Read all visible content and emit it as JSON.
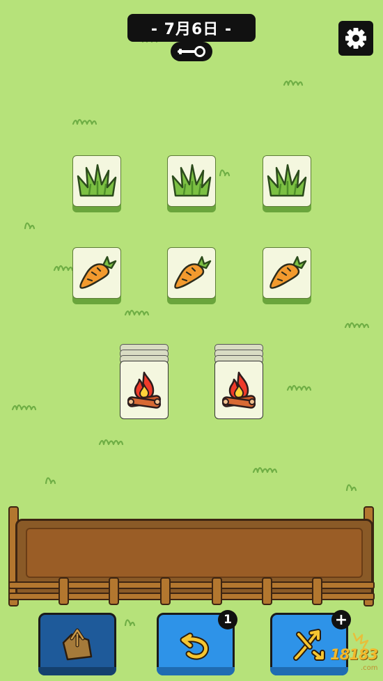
{
  "header": {
    "date_label": "- 7月6日 -",
    "key_icon": "key-icon",
    "settings_icon": "gear-icon"
  },
  "board": {
    "rows": [
      {
        "tiles": [
          "grass",
          "grass",
          "grass"
        ]
      },
      {
        "tiles": [
          "carrot",
          "carrot",
          "carrot"
        ]
      },
      {
        "tiles": [
          "campfire",
          "campfire"
        ]
      }
    ]
  },
  "toolbar": {
    "undo_badge": "1",
    "shuffle_badge": "+"
  },
  "watermark": {
    "text": "18183",
    "domain": ".com"
  },
  "colors": {
    "background": "#b6e27a",
    "tray_wood": "#8a5a27",
    "button_dark_blue": "#1e5a9a",
    "button_blue": "#2e93e8"
  }
}
